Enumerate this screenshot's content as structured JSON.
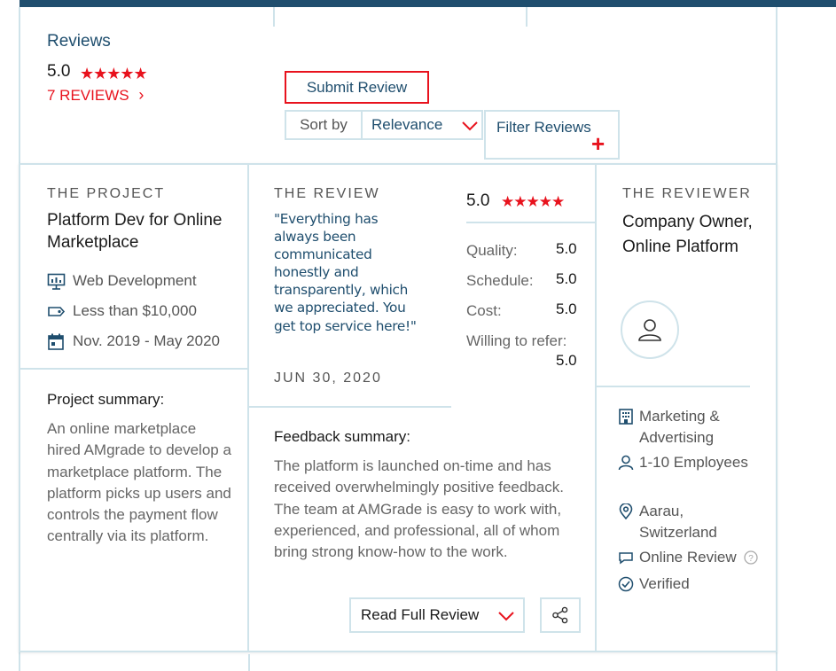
{
  "header": {
    "title": "Reviews",
    "overall_rating": "5.0",
    "stars": "★★★★★",
    "reviews_link": "7 REVIEWS",
    "reviews_link_arrow": "›",
    "submit_label": "Submit Review",
    "sort_label": "Sort by",
    "sort_value": "Relevance",
    "filter_label": "Filter Reviews",
    "filter_plus": "+"
  },
  "project": {
    "section": "THE PROJECT",
    "title": "Platform Dev for Online Marketplace",
    "service": "Web Development",
    "budget": "Less than $10,000",
    "dates": "Nov. 2019 - May 2020",
    "summary_heading": "Project summary:",
    "summary": "An online marketplace hired AMgrade to develop a marketplace platform. The platform picks up users and controls the payment flow centrally via its platform."
  },
  "review": {
    "section": "THE REVIEW",
    "quote": "\"Everything has always been communicated honestly and transparently, which we appreciated. You get top service here!\"",
    "date": "JUN 30, 2020",
    "overall": "5.0",
    "stars": "★★★★★",
    "scores": [
      {
        "label": "Quality:",
        "value": "5.0"
      },
      {
        "label": "Schedule:",
        "value": "5.0"
      },
      {
        "label": "Cost:",
        "value": "5.0"
      },
      {
        "label": "Willing to refer:",
        "value": "5.0"
      }
    ],
    "feedback_heading": "Feedback summary:",
    "feedback": "The platform is launched on-time and has received overwhelmingly positive feedback. The team at AMGrade is easy to work with, experienced, and professional, all of whom bring strong know-how to the work.",
    "read_full_label": "Read Full Review"
  },
  "reviewer": {
    "section": "THE REVIEWER",
    "title": "Company Owner, Online Platform",
    "industry": "Marketing & Advertising",
    "size": "1-10 Employees",
    "location": "Aarau, Switzerland",
    "review_type": "Online Review",
    "verified": "Verified"
  },
  "colors": {
    "accent": "#e8121d",
    "brand": "#1f4e6e",
    "border": "#cfe3ea"
  }
}
